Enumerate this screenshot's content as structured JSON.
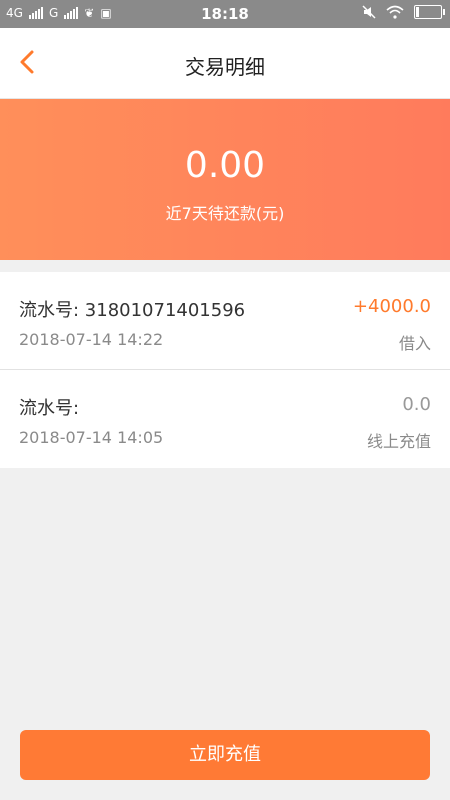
{
  "status_bar": {
    "network_1": "4G",
    "network_2": "G",
    "time": "18:18",
    "icons": [
      "signal-icon",
      "signal-icon",
      "notification-icon",
      "sim-icon",
      "mute-icon",
      "wifi-icon",
      "battery-icon"
    ]
  },
  "header": {
    "title": "交易明细",
    "back_icon": "chevron-left-icon",
    "accent_color": "#ff7a2c"
  },
  "summary": {
    "amount": "0.00",
    "label": "近7天待还款(元)"
  },
  "transactions": [
    {
      "serial": "流水号: 31801071401596",
      "date": "2018-07-14 14:22",
      "value": "+4000.0",
      "type": "借入"
    },
    {
      "serial": "流水号:",
      "date": "2018-07-14 14:05",
      "value": "0.0",
      "type": "线上充值"
    }
  ],
  "footer": {
    "button_label": "立即充值",
    "button_color": "#ff7a35"
  }
}
